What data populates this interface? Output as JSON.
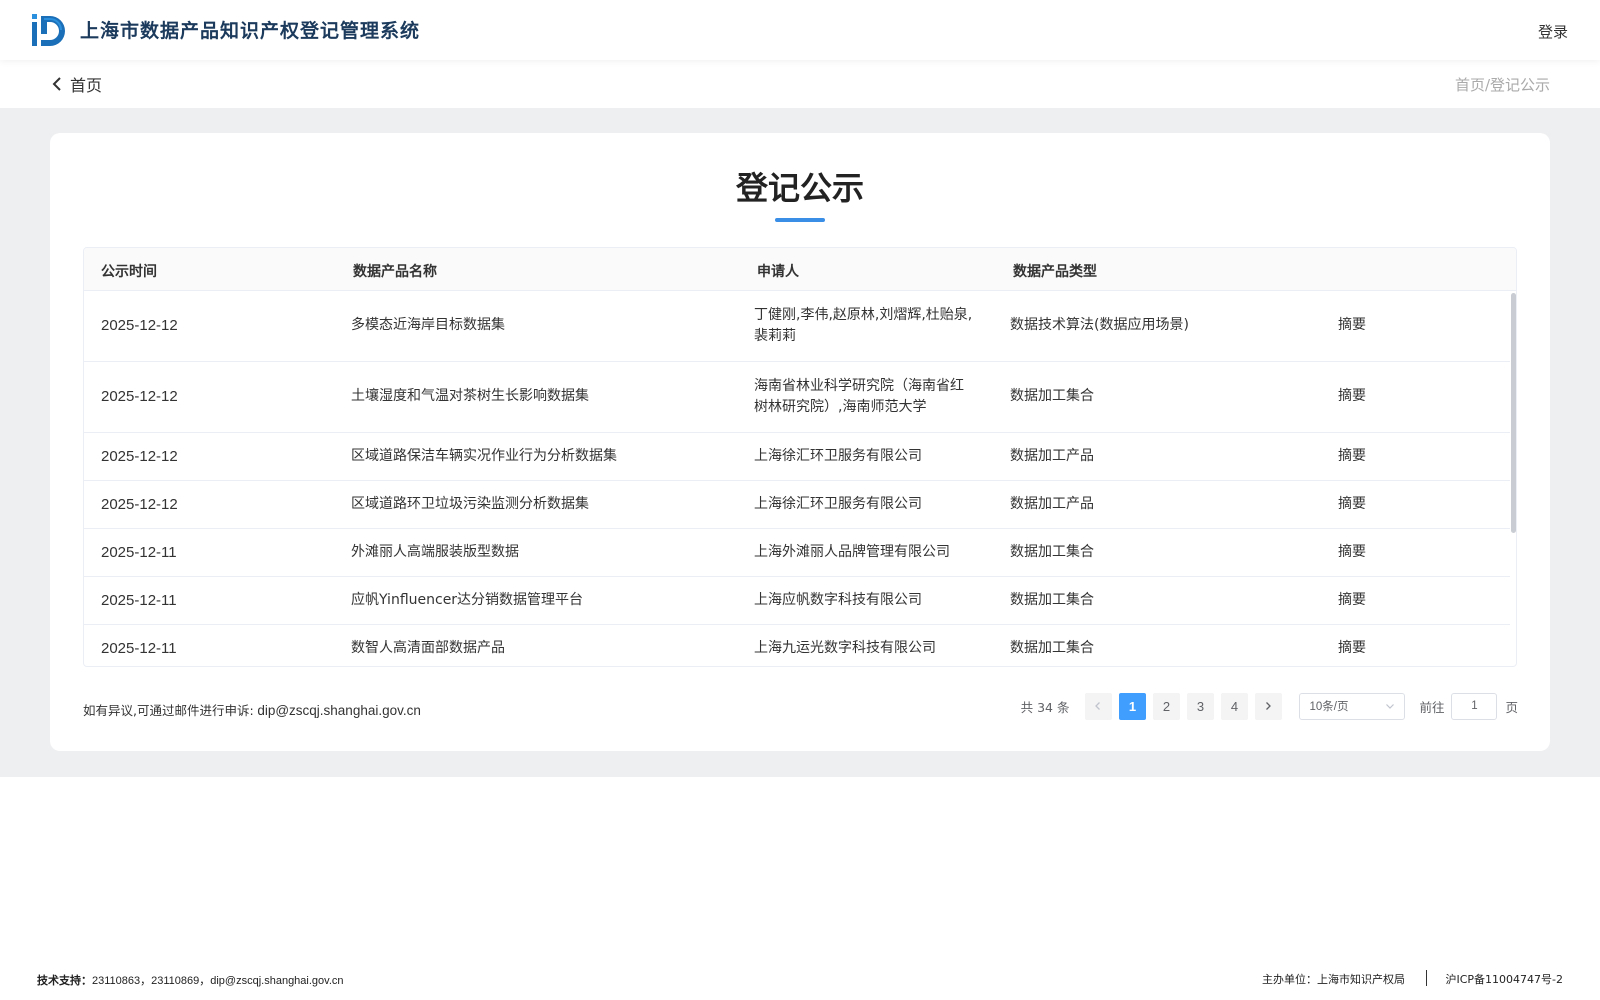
{
  "header": {
    "app_title": "上海市数据产品知识产权登记管理系统",
    "login_label": "登录",
    "brand_color": "#1b3a5c"
  },
  "subnav": {
    "back_label": "首页",
    "breadcrumb": "首页/登记公示"
  },
  "main": {
    "title": "登记公示",
    "accent_color": "#3a8ee6",
    "table": {
      "columns": [
        "公示时间",
        "数据产品名称",
        "申请人",
        "数据产品类型"
      ],
      "rows": [
        {
          "date": "2025-12-12",
          "name": "多模态近海岸目标数据集",
          "applicant": "丁健刚,李伟,赵原林,刘熠辉,杜贻泉,裴莉莉",
          "type": "数据技术算法(数据应用场景)",
          "action": "摘要"
        },
        {
          "date": "2025-12-12",
          "name": "土壤湿度和气温对茶树生长影响数据集",
          "applicant": "海南省林业科学研究院（海南省红树林研究院）,海南师范大学",
          "type": "数据加工集合",
          "action": "摘要"
        },
        {
          "date": "2025-12-12",
          "name": "区域道路保洁车辆实况作业行为分析数据集",
          "applicant": "上海徐汇环卫服务有限公司",
          "type": "数据加工产品",
          "action": "摘要"
        },
        {
          "date": "2025-12-12",
          "name": "区域道路环卫垃圾污染监测分析数据集",
          "applicant": "上海徐汇环卫服务有限公司",
          "type": "数据加工产品",
          "action": "摘要"
        },
        {
          "date": "2025-12-11",
          "name": "外滩丽人高端服装版型数据",
          "applicant": "上海外滩丽人品牌管理有限公司",
          "type": "数据加工集合",
          "action": "摘要"
        },
        {
          "date": "2025-12-11",
          "name": "应帆Yinfluencer达分销数据管理平台",
          "applicant": "上海应帆数字科技有限公司",
          "type": "数据加工集合",
          "action": "摘要"
        },
        {
          "date": "2025-12-11",
          "name": "数智人高清面部数据产品",
          "applicant": "上海九运光数字科技有限公司",
          "type": "数据加工集合",
          "action": "摘要"
        }
      ]
    },
    "notice": {
      "label": "如有异议,可通过邮件进行申诉:",
      "email": "dip@zscqj.shanghai.gov.cn"
    },
    "pagination": {
      "total": "共 34 条",
      "pages": [
        "1",
        "2",
        "3",
        "4"
      ],
      "current": "1",
      "page_size": "10条/页",
      "goto_label": "前往",
      "goto_value": "1",
      "page_suffix": "页",
      "active_color": "#409eff"
    }
  },
  "footer": {
    "tech_label": "技术支持：",
    "tech_value": "23110863，23110869，dip@zscqj.shanghai.gov.cn",
    "host": "主办单位：上海市知识产权局",
    "icp": "沪ICP备11004747号-2"
  }
}
